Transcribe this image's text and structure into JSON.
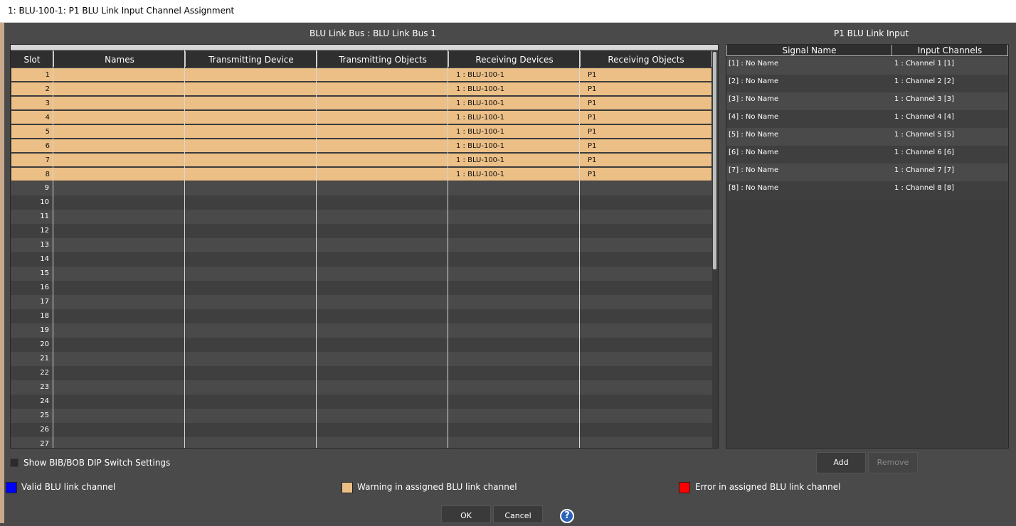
{
  "window": {
    "title": "1: BLU-100-1: P1 BLU Link Input Channel Assignment"
  },
  "main": {
    "title": "BLU Link Bus : BLU Link Bus 1",
    "columns": [
      "Slot",
      "Names",
      "Transmitting Device",
      "Transmitting Objects",
      "Receiving Devices",
      "Receiving Objects"
    ],
    "rows": [
      {
        "slot": "1",
        "receiving_device": "1 : BLU-100-1",
        "receiving_object": "P1",
        "status": "warning"
      },
      {
        "slot": "2",
        "receiving_device": "1 : BLU-100-1",
        "receiving_object": "P1",
        "status": "warning"
      },
      {
        "slot": "3",
        "receiving_device": "1 : BLU-100-1",
        "receiving_object": "P1",
        "status": "warning"
      },
      {
        "slot": "4",
        "receiving_device": "1 : BLU-100-1",
        "receiving_object": "P1",
        "status": "warning"
      },
      {
        "slot": "5",
        "receiving_device": "1 : BLU-100-1",
        "receiving_object": "P1",
        "status": "warning"
      },
      {
        "slot": "6",
        "receiving_device": "1 : BLU-100-1",
        "receiving_object": "P1",
        "status": "warning"
      },
      {
        "slot": "7",
        "receiving_device": "1 : BLU-100-1",
        "receiving_object": "P1",
        "status": "warning"
      },
      {
        "slot": "8",
        "receiving_device": "1 : BLU-100-1",
        "receiving_object": "P1",
        "status": "warning"
      },
      {
        "slot": "9"
      },
      {
        "slot": "10"
      },
      {
        "slot": "11"
      },
      {
        "slot": "12"
      },
      {
        "slot": "13"
      },
      {
        "slot": "14"
      },
      {
        "slot": "15"
      },
      {
        "slot": "16"
      },
      {
        "slot": "17"
      },
      {
        "slot": "18"
      },
      {
        "slot": "19"
      },
      {
        "slot": "20"
      },
      {
        "slot": "21"
      },
      {
        "slot": "22"
      },
      {
        "slot": "23"
      },
      {
        "slot": "24"
      },
      {
        "slot": "25"
      },
      {
        "slot": "26"
      },
      {
        "slot": "27"
      }
    ]
  },
  "right_panel": {
    "title": "P1 BLU Link Input",
    "columns": [
      "Signal Name",
      "Input Channels"
    ],
    "rows": [
      {
        "signal": "[1] : No Name",
        "channel": "1 : Channel 1  [1]"
      },
      {
        "signal": "[2] : No Name",
        "channel": "1 : Channel 2  [2]"
      },
      {
        "signal": "[3] : No Name",
        "channel": "1 : Channel 3  [3]"
      },
      {
        "signal": "[4] : No Name",
        "channel": "1 : Channel 4  [4]"
      },
      {
        "signal": "[5] : No Name",
        "channel": "1 : Channel 5  [5]"
      },
      {
        "signal": "[6] : No Name",
        "channel": "1 : Channel 6  [6]"
      },
      {
        "signal": "[7] : No Name",
        "channel": "1 : Channel 7  [7]"
      },
      {
        "signal": "[8] : No Name",
        "channel": "1 : Channel 8  [8]"
      }
    ],
    "add_label": "Add",
    "remove_label": "Remove"
  },
  "options": {
    "show_dip_label": "Show BIB/BOB DIP Switch Settings",
    "show_dip_checked": false
  },
  "legend": {
    "valid": {
      "label": "Valid BLU link channel",
      "color": "#0000ff"
    },
    "warning": {
      "label": "Warning in assigned BLU link channel",
      "color": "#ebbf86"
    },
    "error": {
      "label": "Error in assigned BLU link channel",
      "color": "#ff0000"
    }
  },
  "footer": {
    "ok_label": "OK",
    "cancel_label": "Cancel",
    "help_icon": "help-icon",
    "help_glyph": "?"
  }
}
